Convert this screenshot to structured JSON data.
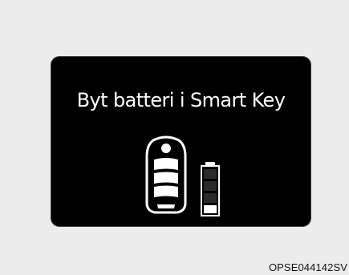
{
  "screen": {
    "message": "Byt batteri i Smart Key"
  },
  "icons": {
    "key": "smart-key-fob-icon",
    "battery": "low-battery-icon"
  },
  "battery_level": 0.2,
  "figure_code": "OPSE044142SV",
  "colors": {
    "background": "#ececec",
    "display": "#000000",
    "foreground": "#ffffff"
  }
}
